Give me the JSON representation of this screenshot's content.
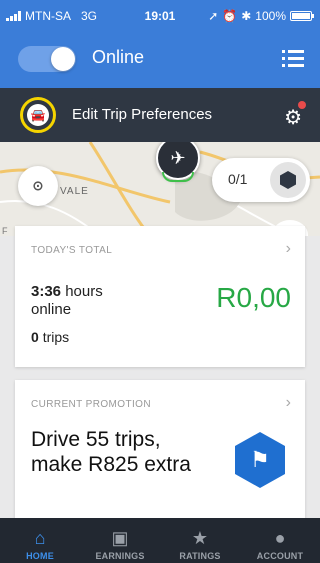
{
  "status_bar": {
    "carrier": "MTN-SA",
    "network": "3G",
    "time": "19:01",
    "battery_percent": "100%",
    "battery_level": 1.0
  },
  "header": {
    "online_toggle_on": true,
    "status_label": "Online",
    "menu_icon": "list-menu-icon"
  },
  "prefs_bar": {
    "label": "Edit Trip Preferences",
    "car_icon": "car-icon",
    "settings_icon": "gear-icon",
    "has_notification": true
  },
  "map": {
    "area_text": "VALE",
    "edge_text": "F",
    "trip_progress": "0/1",
    "airport_icon": "airplane-icon",
    "location_icon": "location-pin-icon"
  },
  "todays_total": {
    "heading": "TODAY'S TOTAL",
    "hours_value": "3:36",
    "hours_unit": "hours",
    "hours_suffix": "online",
    "earnings": "R0,00",
    "trips_count": "0",
    "trips_label": "trips"
  },
  "promotion": {
    "heading": "CURRENT PROMOTION",
    "text": "Drive 55 trips, make R825 extra",
    "icon": "flag-icon"
  },
  "bottom_nav": [
    {
      "label": "HOME",
      "icon": "home-icon",
      "active": true
    },
    {
      "label": "EARNINGS",
      "icon": "wallet-icon",
      "active": false
    },
    {
      "label": "RATINGS",
      "icon": "star-icon",
      "active": false
    },
    {
      "label": "ACCOUNT",
      "icon": "person-icon",
      "active": false
    }
  ],
  "colors": {
    "primary_blue": "#3b7dd8",
    "dark_bar": "#2f3743",
    "earnings_green": "#27a845",
    "nav_active": "#3d8fea"
  }
}
